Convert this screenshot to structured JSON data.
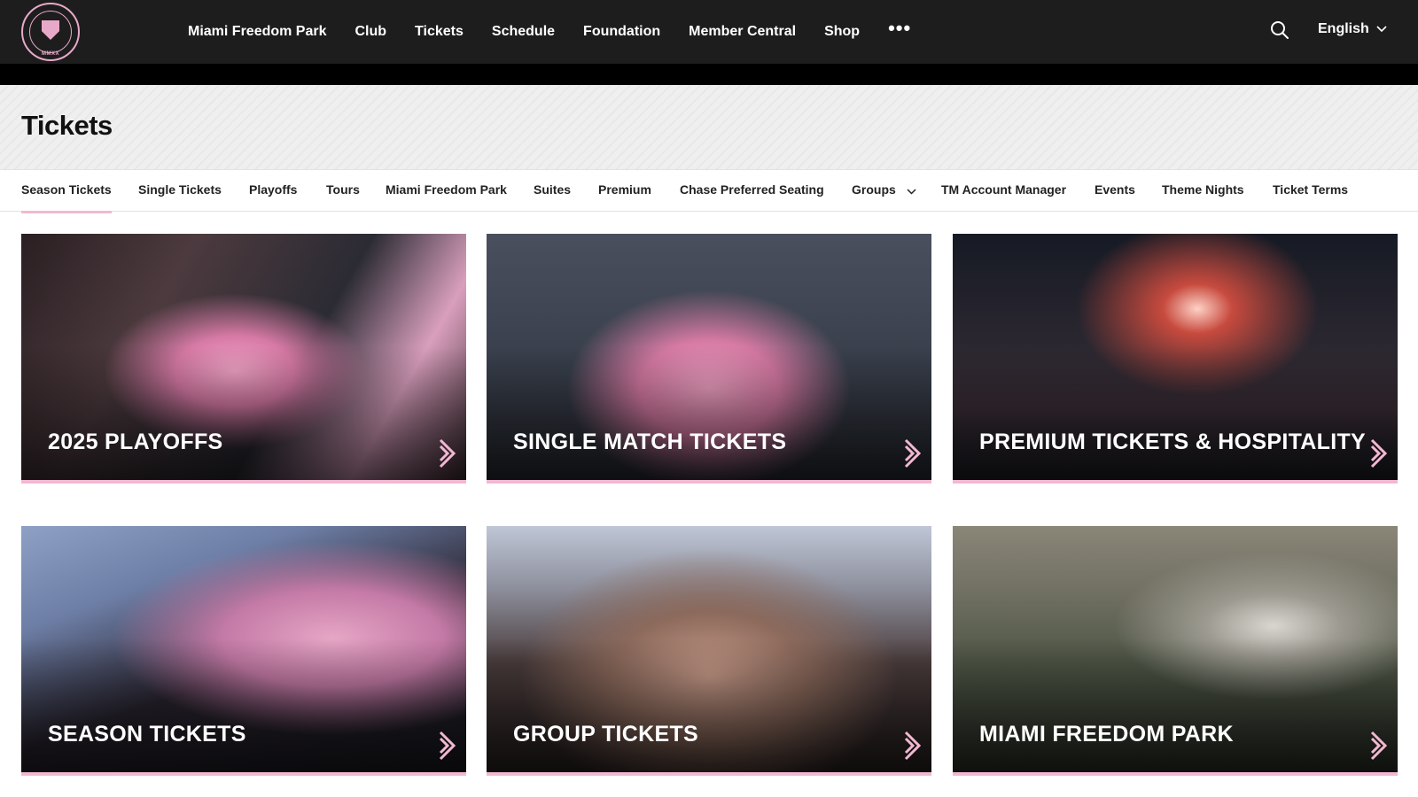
{
  "topnav": {
    "logo_text": "MIAMI",
    "logo_ring_text": "MMXX",
    "links": [
      "Miami Freedom Park",
      "Club",
      "Tickets",
      "Schedule",
      "Foundation",
      "Member Central",
      "Shop"
    ],
    "more_label": "•••",
    "language": "English"
  },
  "page": {
    "title": "Tickets"
  },
  "subnav": {
    "items": [
      "Season Tickets",
      "Single Tickets",
      "Playoffs",
      "Tours",
      "Miami Freedom Park",
      "Suites",
      "Premium",
      "Chase Preferred Seating",
      "Groups",
      "TM Account Manager",
      "Events",
      "Theme Nights",
      "Ticket Terms"
    ],
    "active": "Season Tickets"
  },
  "cards": [
    {
      "label": "2025 PLAYOFFS"
    },
    {
      "label": "SINGLE MATCH TICKETS"
    },
    {
      "label": "PREMIUM TICKETS & HOSPITALITY"
    },
    {
      "label": "SEASON TICKETS"
    },
    {
      "label": "GROUP TICKETS"
    },
    {
      "label": "MIAMI FREEDOM PARK"
    }
  ],
  "colors": {
    "accent_pink": "#f2b8d1",
    "nav_bg": "#1d1d1d"
  }
}
